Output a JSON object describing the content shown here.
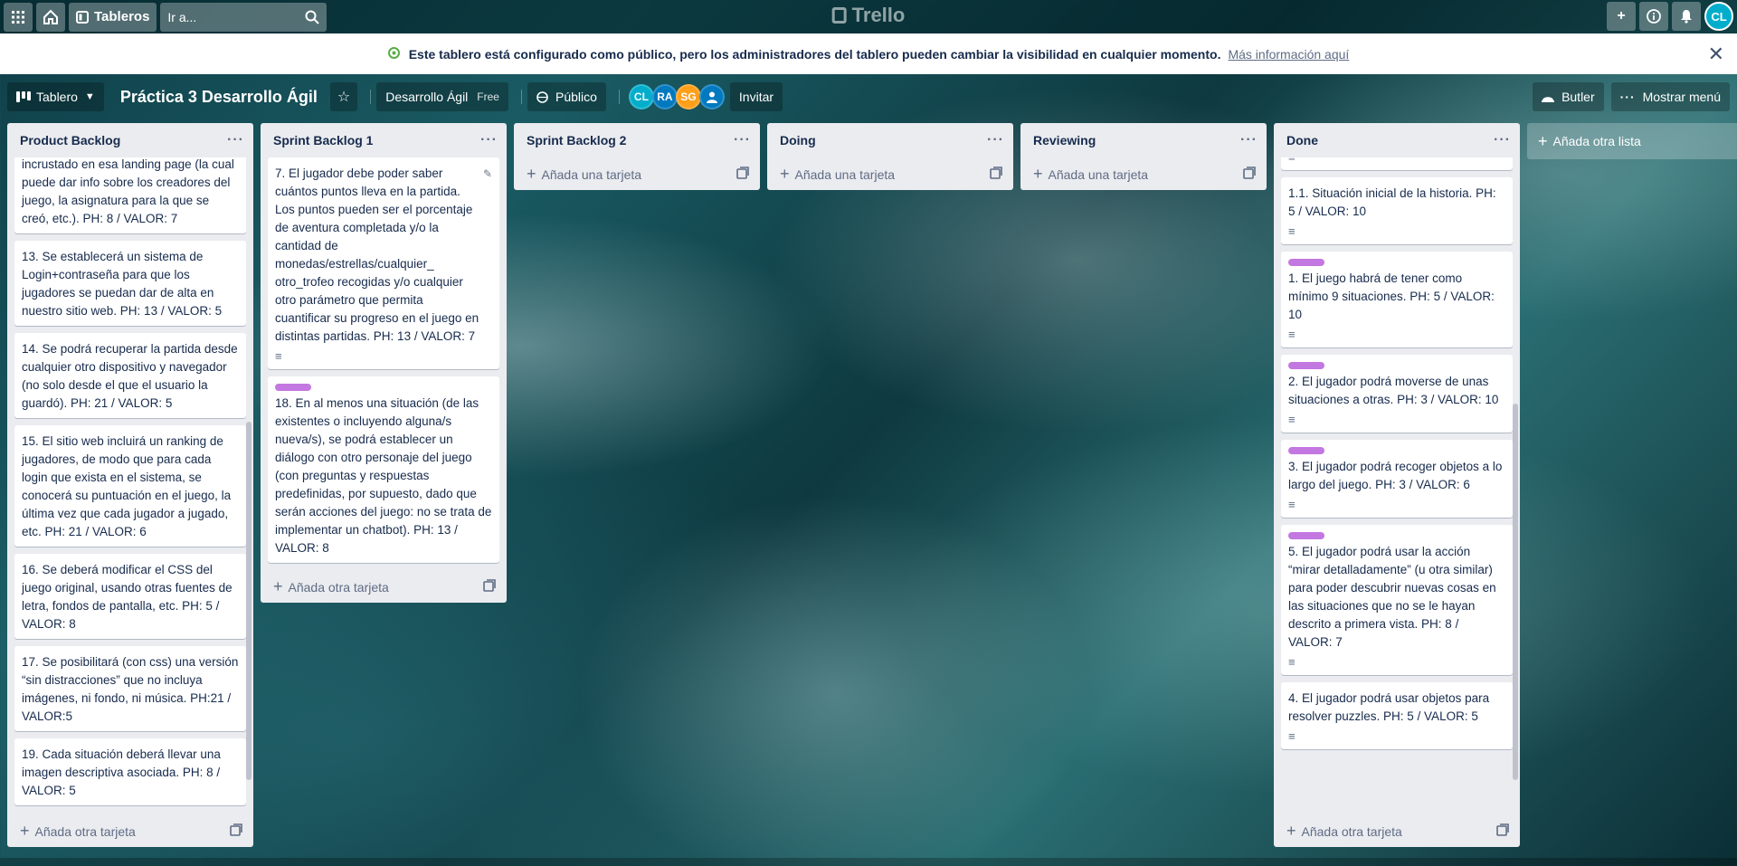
{
  "header": {
    "boards_label": "Tableros",
    "search_placeholder": "Ir a...",
    "logo": "Trello",
    "user_initials": "CL"
  },
  "banner": {
    "message": "Este tablero está configurado como público, pero los administradores del tablero pueden cambiar la visibilidad en cualquier momento.",
    "link": "Más información aquí"
  },
  "board": {
    "view": "Tablero",
    "title": "Práctica 3 Desarrollo Ágil",
    "workspace": "Desarrollo Ágil",
    "plan": "Free",
    "visibility": "Público",
    "members": [
      "CL",
      "RA",
      "SG",
      ""
    ],
    "invite": "Invitar",
    "butler": "Butler",
    "show_menu": "Mostrar menú"
  },
  "lists": [
    {
      "title": "Product Backlog",
      "add": "Añada otra tarjeta",
      "cards": [
        {
          "text": "incrustado en esa landing page (la cual puede dar info sobre los creadores del juego, la asignatura para la que se creó, etc.). PH: 8 / VALOR: 7"
        },
        {
          "text": "13. Se establecerá un sistema de Login+contraseña para que los jugadores se puedan dar de alta en nuestro sitio web. PH: 13 / VALOR: 5"
        },
        {
          "text": "14. Se podrá recuperar la partida desde cualquier otro dispositivo y navegador (no solo desde el que el usuario la guardó). PH: 21 / VALOR: 5"
        },
        {
          "text": "15. El sitio web incluirá un ranking de jugadores, de modo que para cada login que exista en el sistema, se conocerá su puntuación en el juego, la última vez que cada jugador a jugado, etc. PH: 21 / VALOR: 6"
        },
        {
          "text": "16. Se deberá modificar el CSS del juego original, usando otras fuentes de letra, fondos de pantalla, etc. PH: 5 / VALOR: 8"
        },
        {
          "text": "17. Se posibilitará (con css) una versión “sin distracciones” que no incluya imágenes, ni fondo, ni música. PH:21 / VALOR:5"
        },
        {
          "text": "19. Cada situación deberá llevar una imagen descriptiva asociada. PH: 8 / VALOR: 5"
        }
      ]
    },
    {
      "title": "Sprint Backlog 1",
      "add": "Añada otra tarjeta",
      "cards": [
        {
          "text": "7. El jugador debe poder saber cuántos puntos lleva en la partida. Los puntos pueden ser el porcentaje de aventura completada y/o la cantidad de monedas/estrellas/cualquier_ otro_trofeo recogidas y/o cualquier otro parámetro que permita cuantificar su progreso en el juego en distintas partidas. PH: 13 / VALOR: 7"
        },
        {
          "text": "18. En al menos una situación (de las existentes o incluyendo alguna/s nueva/s), se podrá establecer un diálogo con otro personaje del juego (con preguntas y respuestas predefinidas, por supuesto, dado que serán acciones del juego: no se trata de implementar un chatbot). PH: 13 / VALOR: 8"
        }
      ]
    },
    {
      "title": "Sprint Backlog 2",
      "add": "Añada una tarjeta"
    },
    {
      "title": "Doing",
      "add": "Añada una tarjeta"
    },
    {
      "title": "Reviewing",
      "add": "Añada una tarjeta"
    },
    {
      "title": "Done",
      "add": "Añada otra tarjeta",
      "cards": [
        {
          "text": "1.1. Situación inicial de la historia. PH: 5 / VALOR: 10"
        },
        {
          "text": "1. El juego habrá de tener como mínimo 9 situaciones. PH: 5 / VALOR: 10"
        },
        {
          "text": "2. El jugador podrá moverse de unas situaciones a otras. PH: 3 / VALOR: 10"
        },
        {
          "text": "3. El jugador podrá recoger objetos a lo largo del juego. PH: 3 / VALOR: 6"
        },
        {
          "text": "5. El jugador podrá usar la acción “mirar detalladamente” (u otra similar) para poder descubrir nuevas cosas en las situaciones que no se le hayan descrito a primera vista. PH: 8 / VALOR: 7"
        },
        {
          "text": "4. El jugador podrá usar objetos para resolver puzzles. PH: 5 / VALOR: 5"
        }
      ]
    }
  ],
  "add_list": "Añada otra lista",
  "colors": {
    "label_purple": "#c377e0",
    "list_bg": "#ebecf0",
    "accent": "#00aecc"
  }
}
